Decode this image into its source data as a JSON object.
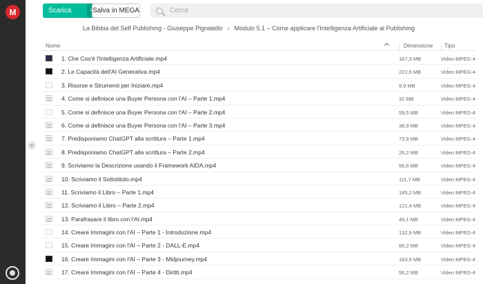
{
  "toolbar": {
    "download_label": "Scarica",
    "save_label": "Salva in MEGA",
    "search_placeholder": "Cerca"
  },
  "breadcrumb": {
    "root": "La Bibbia del Self Publishing - Giuseppe Pignatello",
    "current": "Modulo 5.1 – Come applicare l'Intelligenza Artificiale al Publishing"
  },
  "table": {
    "headers": {
      "name": "Nome",
      "size": "Dimensione",
      "type": "Tipo"
    },
    "rows": [
      {
        "name": "1. Che Cos'è l'Intelligenza Artificiale.mp4",
        "size": "167,3 MB",
        "type": "Video MPEG-4"
      },
      {
        "name": "2. Le Capacità dell'AI Generativa.mp4",
        "size": "222,6 MB",
        "type": "Video MPEG-4"
      },
      {
        "name": "3. Risorse e Strumenti per Iniziare.mp4",
        "size": "9,9 MB",
        "type": "Video MPEG-4"
      },
      {
        "name": "4. Come si definisce una Buyer Persona con l'AI – Parte 1.mp4",
        "size": "32 MB",
        "type": "Video MPEG-4"
      },
      {
        "name": "5. Come si definisce una Buyer Persona con l'AI – Parte 2.mp4",
        "size": "59,5 MB",
        "type": "Video MPEG-4"
      },
      {
        "name": "6. Come si definisce una Buyer Persona con l'AI – Parte 3.mp4",
        "size": "38,9 MB",
        "type": "Video MPEG-4"
      },
      {
        "name": "7. Predisponiamo ChatGPT alla scrittura – Parte 1.mp4",
        "size": "73,9 MB",
        "type": "Video MPEG-4"
      },
      {
        "name": "8. Predisponiamo ChatGPT alla scrittura – Parte 2.mp4",
        "size": "26,2 MB",
        "type": "Video MPEG-4"
      },
      {
        "name": "9. Scriviamo la Descrizione usando il Framework AIDA.mp4",
        "size": "56,6 MB",
        "type": "Video MPEG-4"
      },
      {
        "name": "10. Scriviamo il Sottotitolo.mp4",
        "size": "111,7 MB",
        "type": "Video MPEG-4"
      },
      {
        "name": "11. Scriviamo il Libro – Parte 1.mp4",
        "size": "185,2 MB",
        "type": "Video MPEG-4"
      },
      {
        "name": "12. Scriviamo il Libro – Parte 2.mp4",
        "size": "121,4 MB",
        "type": "Video MPEG-4"
      },
      {
        "name": "13. Parafrasare il libro con l'AI.mp4",
        "size": "49,1 MB",
        "type": "Video MPEG-4"
      },
      {
        "name": "14. Creare Immagini con l'AI – Parte 1 - Introduzione.mp4",
        "size": "132,9 MB",
        "type": "Video MPEG-4"
      },
      {
        "name": "15. Creare Immagini con l'AI – Parte 2 - DALL-E.mp4",
        "size": "66,2 MB",
        "type": "Video MPEG-4"
      },
      {
        "name": "16. Creare Immagini con l'AI – Parte 3 - Midjourney.mp4",
        "size": "163,9 MB",
        "type": "Video MPEG-4"
      },
      {
        "name": "17. Creare Immagini con l'AI – Parte 4 - Diritti.mp4",
        "size": "56,2 MB",
        "type": "Video MPEG-4"
      }
    ]
  },
  "icons": {
    "logo": "mega-logo-icon",
    "search": "search-icon",
    "profile": "profile-icon",
    "collapse": "chevron-double-right-icon"
  },
  "colors": {
    "accent": "#00bd9b",
    "brand": "#d9272e",
    "sidebar": "#2b2b2b"
  }
}
